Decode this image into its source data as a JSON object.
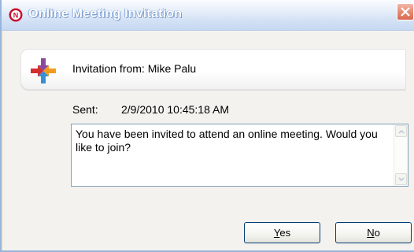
{
  "window": {
    "title": "Online Meeting Invitation",
    "app_icon": "novell-n-icon",
    "close_icon": "close-icon"
  },
  "header": {
    "logo_icon": "meeting-logo-icon",
    "invite_from": "Invitation from: Mike Palu"
  },
  "details": {
    "sent_label": "Sent:",
    "sent_value": "2/9/2010 10:45:18 AM"
  },
  "message": {
    "text": "You have been invited to attend an online meeting. Would you like to join?"
  },
  "buttons": {
    "yes_mnemonic": "Y",
    "yes_rest": "es",
    "no_mnemonic": "N",
    "no_rest": "o"
  },
  "colors": {
    "titlebar": "#d3e1f5",
    "close_button": "#e78a73",
    "button_border": "#003c74"
  }
}
